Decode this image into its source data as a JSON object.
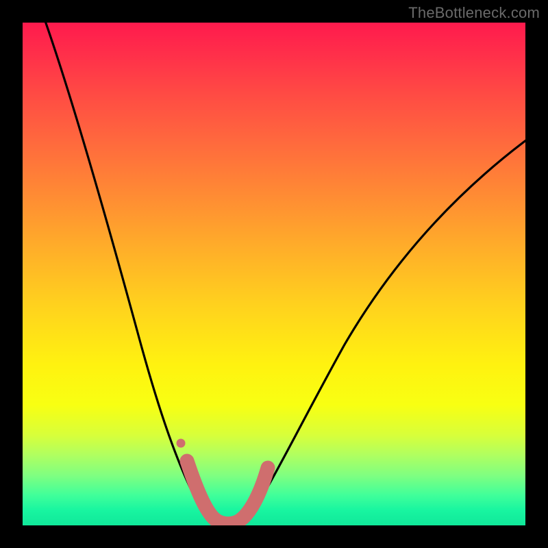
{
  "watermark": "TheBottleneck.com",
  "colors": {
    "frame": "#000000",
    "curve_stroke": "#000000",
    "marker_stroke": "#cf6e6e",
    "marker_fill": "#cf6e6e"
  },
  "chart_data": {
    "type": "line",
    "title": "",
    "xlabel": "",
    "ylabel": "",
    "xlim": [
      0,
      100
    ],
    "ylim": [
      0,
      100
    ],
    "x": [
      0,
      3,
      6,
      9,
      12,
      15,
      18,
      21,
      24,
      27,
      30,
      32,
      34,
      36,
      38,
      40,
      42,
      44,
      46,
      50,
      55,
      60,
      65,
      70,
      75,
      80,
      85,
      90,
      95,
      100
    ],
    "values": [
      104,
      96,
      87,
      78,
      70,
      62,
      54,
      46,
      38,
      30,
      22,
      16,
      11,
      7,
      3.5,
      1.2,
      1.2,
      3.5,
      8,
      17,
      28,
      37,
      45,
      52,
      58,
      63,
      67.5,
      71.5,
      75,
      78
    ],
    "note": "Values are bottleneck percent (y-axis, 0 at bottom). Curve minimum ≈ 1% near x≈41; left branch exits top near x≈0; right branch reaches ≈78% at x=100.",
    "markers": {
      "x": [
        32.0,
        33.3,
        35.0,
        37.0,
        39.0,
        41.0,
        43.0,
        45.0,
        46.7
      ],
      "y": [
        14.0,
        9.0,
        5.5,
        3.0,
        1.6,
        1.2,
        1.6,
        3.0,
        6.5
      ],
      "radius_px": 10,
      "single_dot": {
        "x": 31.3,
        "y": 17.5,
        "radius_px": 6
      }
    }
  }
}
